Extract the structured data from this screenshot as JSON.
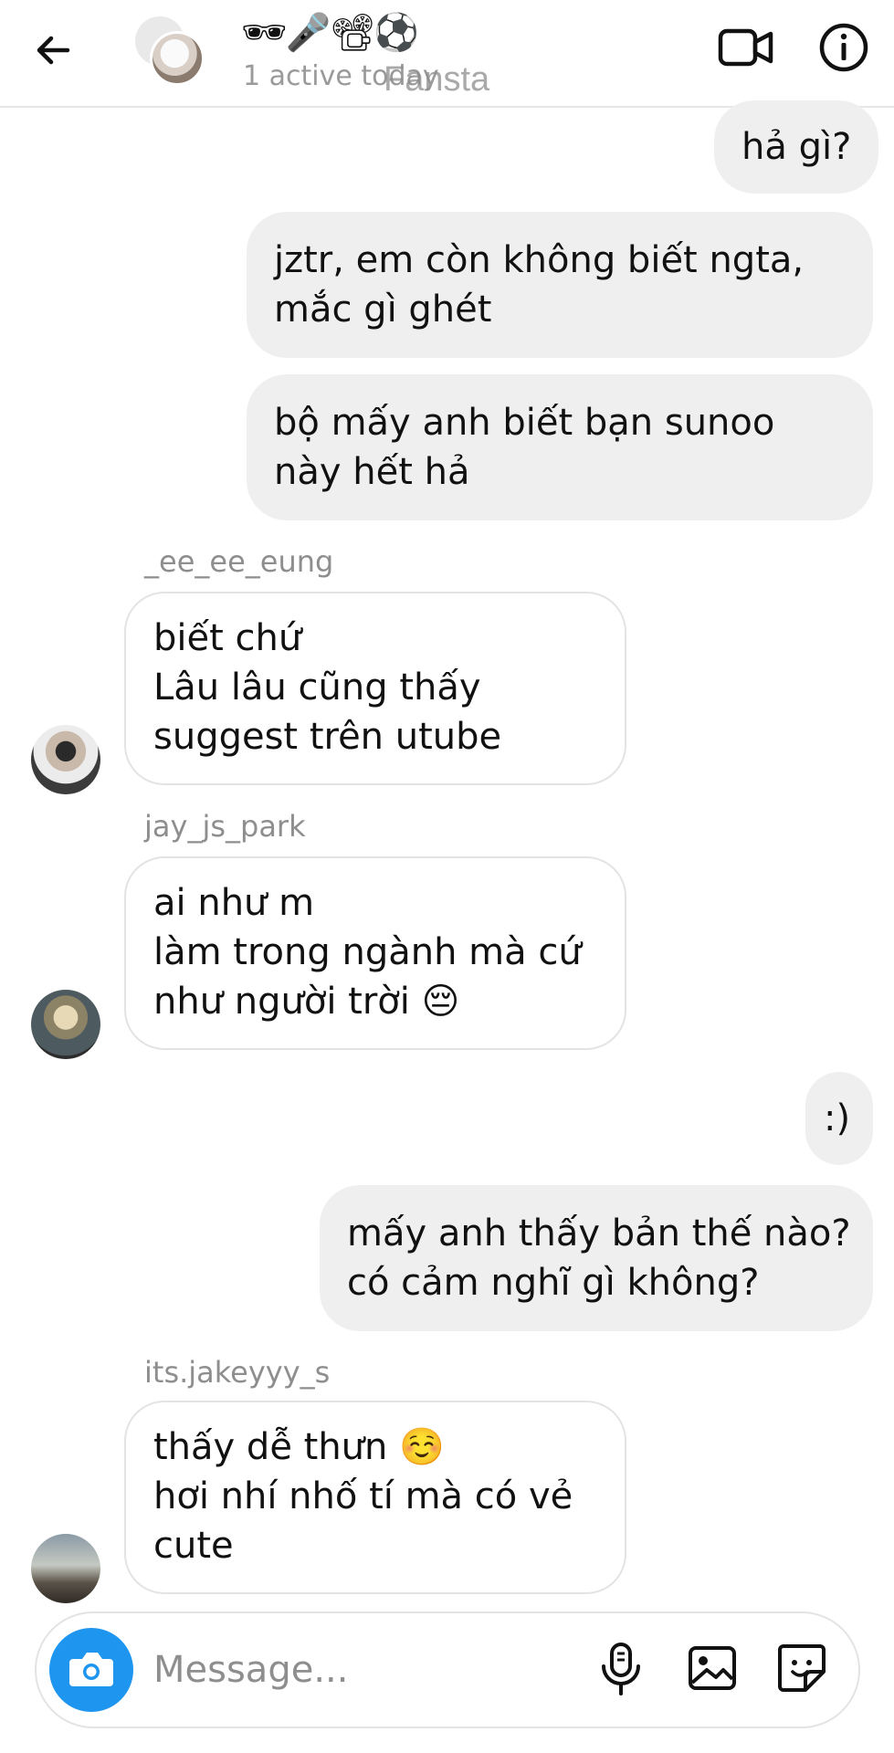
{
  "header": {
    "title": "🕶🎤📽⚽",
    "subtitle": "1 active today",
    "watermark": "Fansta"
  },
  "messages": [
    {
      "from": "me",
      "lines": [
        "hả gì?"
      ]
    },
    {
      "from": "me",
      "lines": [
        "jztr, em còn không biết ngta,",
        "mắc gì ghét"
      ]
    },
    {
      "from": "me",
      "lines": [
        "bộ mấy anh biết bạn sunoo",
        "này hết hả"
      ]
    },
    {
      "from": "them",
      "sender": "_ee_ee_eung",
      "lines": [
        "biết chứ",
        "Lâu lâu cũng thấy",
        "suggest trên utube"
      ]
    },
    {
      "from": "them",
      "sender": "jay_js_park",
      "lines": [
        "ai như m",
        "làm trong ngành mà cứ",
        "như người trời 😔"
      ]
    },
    {
      "from": "me",
      "lines": [
        ":)"
      ]
    },
    {
      "from": "me",
      "lines": [
        "mấy anh thấy bản thế nào?",
        "có cảm nghĩ gì không?"
      ]
    },
    {
      "from": "them",
      "sender": "its.jakeyyy_s",
      "lines": [
        "thấy dễ thưn ☺️",
        "hơi nhí nhố tí mà có vẻ",
        "cute"
      ]
    }
  ],
  "composer": {
    "placeholder": "Message..."
  },
  "colors": {
    "accent": "#1e96f0",
    "my_bubble": "#efefef",
    "their_bubble_border": "#e3e3e3",
    "muted_text": "#8e8e8e"
  },
  "icons": [
    "back-arrow-icon",
    "video-call-icon",
    "info-icon",
    "camera-icon",
    "microphone-icon",
    "gallery-icon",
    "sticker-icon"
  ]
}
